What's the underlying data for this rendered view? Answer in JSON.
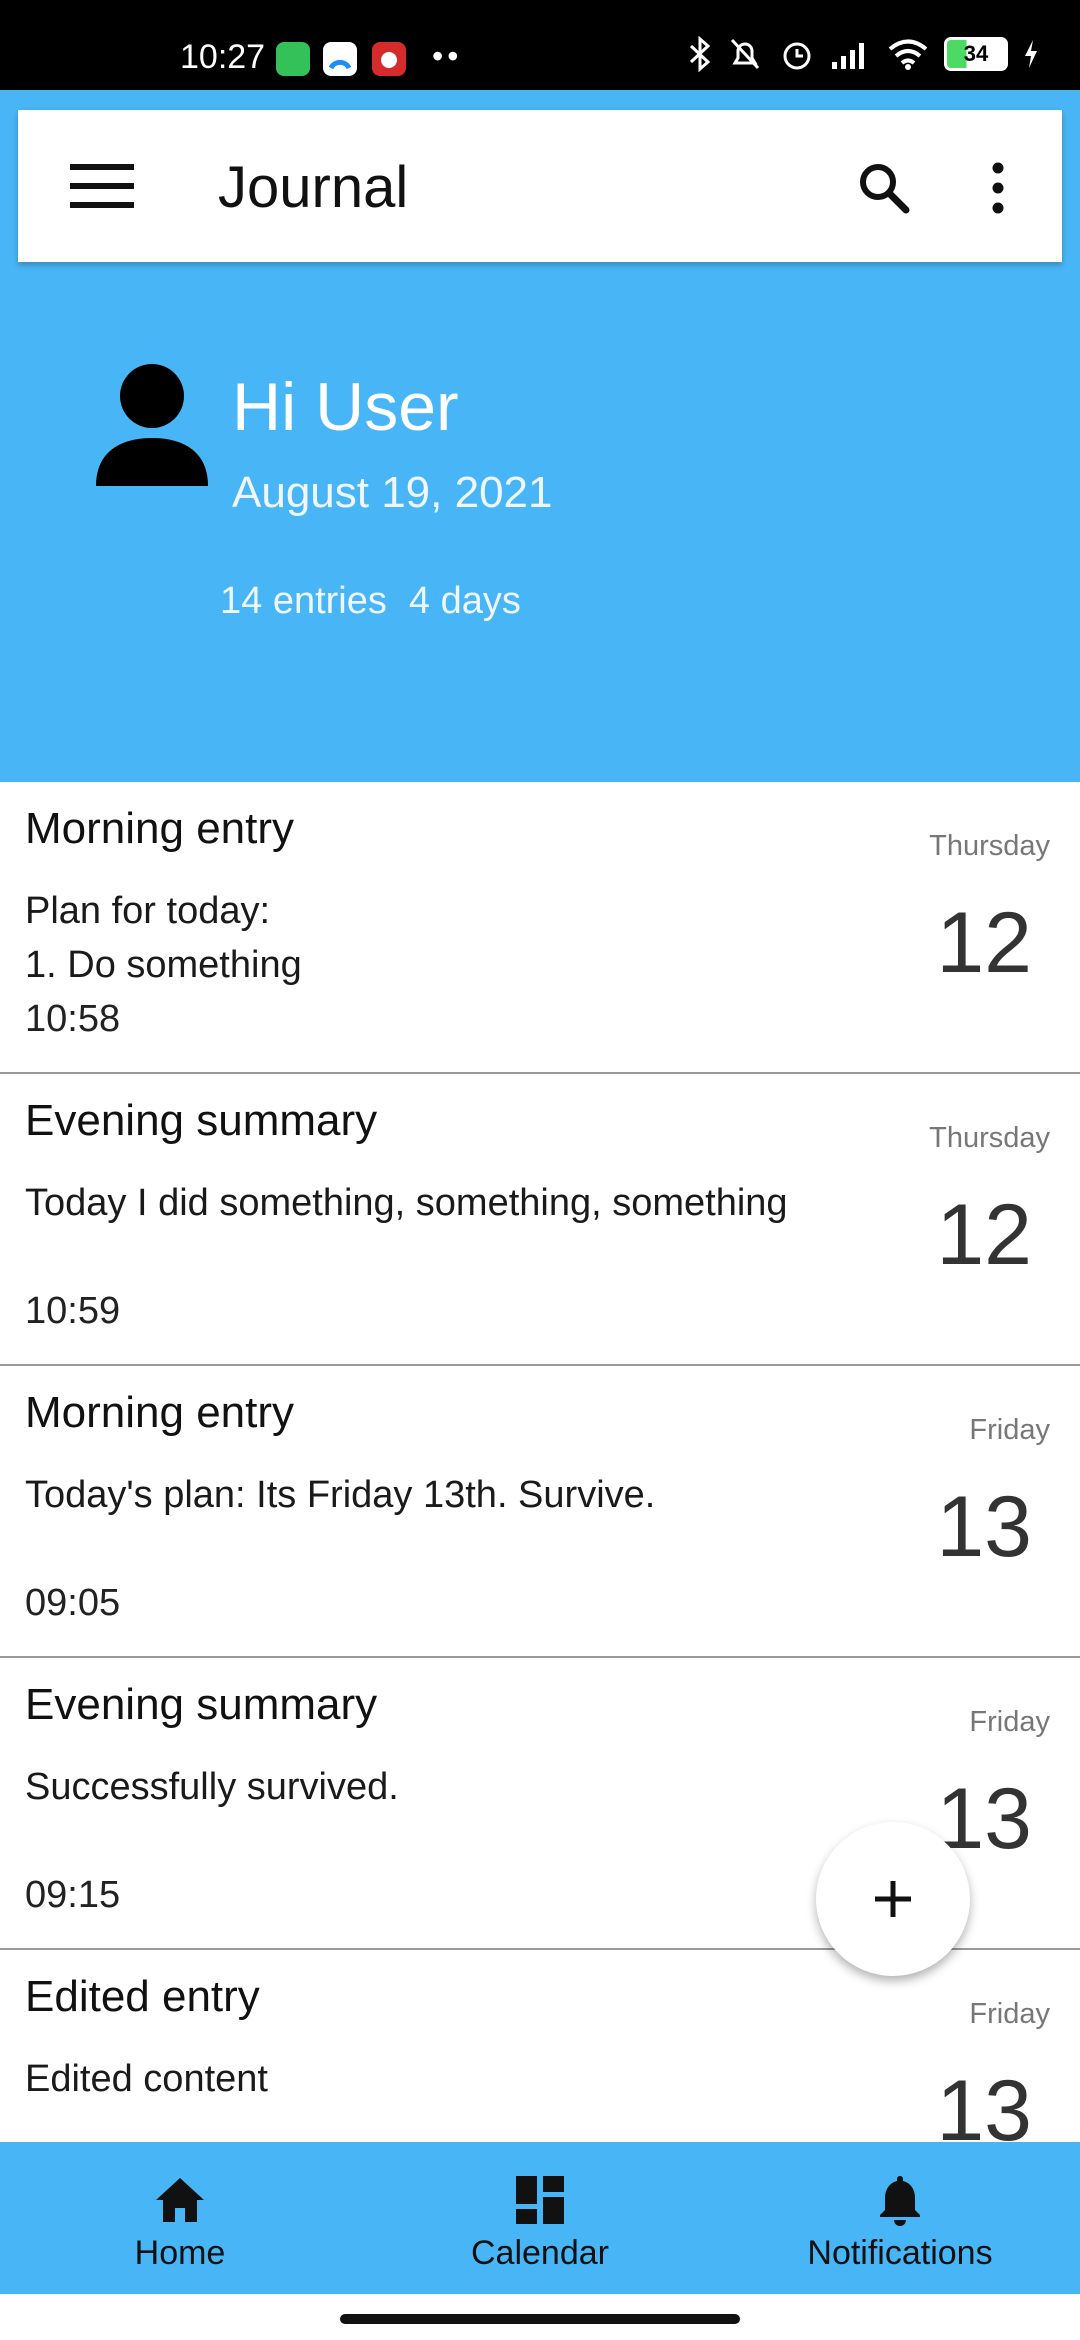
{
  "status_bar": {
    "time": "10:27",
    "battery": "34",
    "app_icons": [
      "green-app-icon",
      "blue-app-icon",
      "red-app-icon"
    ],
    "dots": "••"
  },
  "appbar": {
    "title": "Journal",
    "menu_icon": "menu-icon",
    "search_icon": "search-icon",
    "more_icon": "more-vert-icon"
  },
  "profile": {
    "greeting": "Hi User",
    "date": "August 19, 2021",
    "entries_count": "14 entries",
    "days_count": "4 days"
  },
  "entries": [
    {
      "title": "Morning entry",
      "body": "Plan for today:\n1. Do something",
      "time": "10:58",
      "weekday": "Thursday",
      "day": "12"
    },
    {
      "title": "Evening summary",
      "body": "Today I did something, something, something",
      "time": "10:59",
      "weekday": "Thursday",
      "day": "12"
    },
    {
      "title": "Morning entry",
      "body": "Today's plan: Its Friday 13th. Survive.",
      "time": "09:05",
      "weekday": "Friday",
      "day": "13"
    },
    {
      "title": "Evening summary",
      "body": "Successfully survived.",
      "time": "09:15",
      "weekday": "Friday",
      "day": "13"
    },
    {
      "title": "Edited entry",
      "body": "Edited content",
      "time": "",
      "weekday": "Friday",
      "day": "13"
    }
  ],
  "fab": {
    "icon": "plus-icon"
  },
  "bottom_nav": [
    {
      "label": "Home",
      "icon": "home-icon"
    },
    {
      "label": "Calendar",
      "icon": "dashboard-icon"
    },
    {
      "label": "Notifications",
      "icon": "bell-icon"
    }
  ],
  "colors": {
    "accent": "#48b6f6",
    "status_bar": "#000000"
  }
}
